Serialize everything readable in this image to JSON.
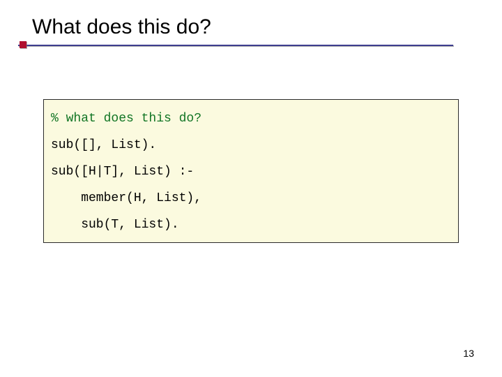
{
  "slide": {
    "title": "What does this do?",
    "page_number": "13"
  },
  "code": {
    "comment": "% what does this do?",
    "line1": "sub([], List).",
    "line2": "sub([H|T], List) :-",
    "line3": "    member(H, List),",
    "line4": "    sub(T, List)."
  }
}
